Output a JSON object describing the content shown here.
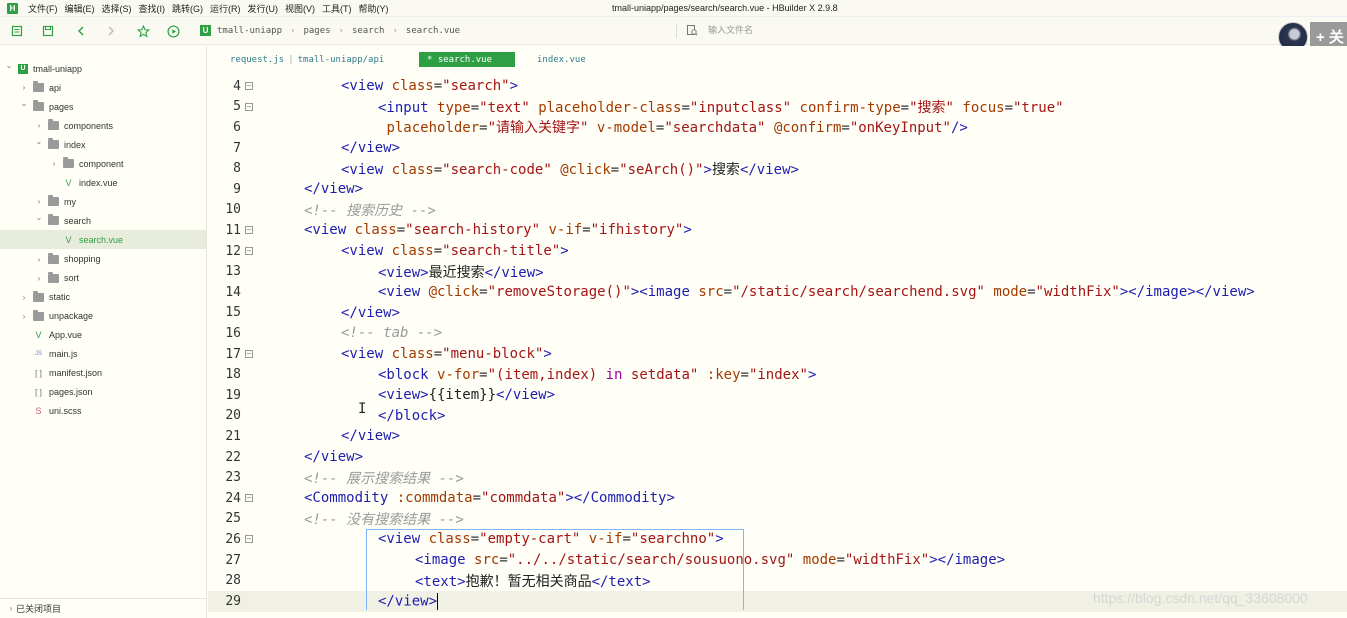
{
  "menubar": {
    "logo": "H",
    "items": [
      "文件(F)",
      "编辑(E)",
      "选择(S)",
      "查找(I)",
      "跳转(G)",
      "运行(R)",
      "发行(U)",
      "视图(V)",
      "工具(T)",
      "帮助(Y)"
    ],
    "window_title": "tmall-uniapp/pages/search/search.vue - HBuilder X 2.9.8"
  },
  "toolbar": {
    "breadcrumb_logo": "U",
    "breadcrumb": [
      "tmall-uniapp",
      "pages",
      "search",
      "search.vue"
    ],
    "file_search_placeholder": "输入文件名",
    "plus_label": "+ 关"
  },
  "sidebar": {
    "tree": [
      {
        "label": "tmall-uniapp",
        "kind": "project",
        "expanded": true,
        "depth": 0
      },
      {
        "label": "api",
        "kind": "folder",
        "expanded": false,
        "depth": 1
      },
      {
        "label": "pages",
        "kind": "folder",
        "expanded": true,
        "depth": 1
      },
      {
        "label": "components",
        "kind": "folder",
        "expanded": false,
        "depth": 2
      },
      {
        "label": "index",
        "kind": "folder",
        "expanded": true,
        "depth": 2
      },
      {
        "label": "component",
        "kind": "folder",
        "expanded": false,
        "depth": 3
      },
      {
        "label": "index.vue",
        "kind": "vue",
        "depth": 3
      },
      {
        "label": "my",
        "kind": "folder",
        "expanded": false,
        "depth": 2
      },
      {
        "label": "search",
        "kind": "folder",
        "expanded": true,
        "depth": 2
      },
      {
        "label": "search.vue",
        "kind": "vue",
        "depth": 3,
        "selected": true
      },
      {
        "label": "shopping",
        "kind": "folder",
        "expanded": false,
        "depth": 2
      },
      {
        "label": "sort",
        "kind": "folder",
        "expanded": false,
        "depth": 2
      },
      {
        "label": "static",
        "kind": "folder",
        "expanded": false,
        "depth": 1
      },
      {
        "label": "unpackage",
        "kind": "folder",
        "expanded": false,
        "depth": 1
      },
      {
        "label": "App.vue",
        "kind": "vue",
        "depth": 1
      },
      {
        "label": "main.js",
        "kind": "js",
        "depth": 1
      },
      {
        "label": "manifest.json",
        "kind": "json",
        "depth": 1
      },
      {
        "label": "pages.json",
        "kind": "json",
        "depth": 1
      },
      {
        "label": "uni.scss",
        "kind": "scss",
        "depth": 1
      }
    ],
    "closed_items_label": "已关闭项目"
  },
  "tabs": [
    {
      "label": "request.js",
      "sub": "tmall-uniapp/api",
      "active": false
    },
    {
      "label": "* search.vue",
      "active": true
    },
    {
      "label": "index.vue",
      "active": false
    }
  ],
  "editor": {
    "lines": [
      {
        "n": "4",
        "fold": true,
        "indent": 2,
        "tokens": [
          [
            "t",
            "<view "
          ],
          [
            "a",
            "class"
          ],
          [
            "s",
            "="
          ],
          [
            "sv",
            "\"search\""
          ],
          [
            "t",
            ">"
          ]
        ]
      },
      {
        "n": "5",
        "fold": true,
        "indent": 3,
        "tokens": [
          [
            "t",
            "<input "
          ],
          [
            "a",
            "type"
          ],
          [
            "s",
            "="
          ],
          [
            "sv",
            "\"text\""
          ],
          [
            "s",
            " "
          ],
          [
            "a",
            "placeholder-class"
          ],
          [
            "s",
            "="
          ],
          [
            "sv",
            "\"inputclass\""
          ],
          [
            "s",
            " "
          ],
          [
            "a",
            "confirm-type"
          ],
          [
            "s",
            "="
          ],
          [
            "sv",
            "\"搜索\""
          ],
          [
            "s",
            " "
          ],
          [
            "a",
            "focus"
          ],
          [
            "s",
            "="
          ],
          [
            "sv",
            "\"true\""
          ]
        ]
      },
      {
        "n": "6",
        "fold": false,
        "indent": 3,
        "tokens": [
          [
            "s",
            " "
          ],
          [
            "a",
            "placeholder"
          ],
          [
            "s",
            "="
          ],
          [
            "sv",
            "\"请输入关键字\""
          ],
          [
            "s",
            " "
          ],
          [
            "a",
            "v-model"
          ],
          [
            "s",
            "="
          ],
          [
            "sv",
            "\"searchdata\""
          ],
          [
            "s",
            " "
          ],
          [
            "a",
            "@confirm"
          ],
          [
            "s",
            "="
          ],
          [
            "sv",
            "\"onKeyInput\""
          ],
          [
            "t",
            "/>"
          ]
        ]
      },
      {
        "n": "7",
        "fold": false,
        "indent": 2,
        "tokens": [
          [
            "t",
            "</view>"
          ]
        ]
      },
      {
        "n": "8",
        "fold": false,
        "indent": 2,
        "tokens": [
          [
            "t",
            "<view "
          ],
          [
            "a",
            "class"
          ],
          [
            "s",
            "="
          ],
          [
            "sv",
            "\"search-code\""
          ],
          [
            "s",
            " "
          ],
          [
            "a",
            "@click"
          ],
          [
            "s",
            "="
          ],
          [
            "sv",
            "\"seArch()\""
          ],
          [
            "t",
            ">"
          ],
          [
            "tx",
            "搜索"
          ],
          [
            "t",
            "</view>"
          ]
        ]
      },
      {
        "n": "9",
        "fold": false,
        "indent": 1,
        "tokens": [
          [
            "t",
            "</view>"
          ]
        ]
      },
      {
        "n": "10",
        "fold": false,
        "indent": 1,
        "tokens": [
          [
            "c",
            "<!-- 搜索历史 -->"
          ]
        ]
      },
      {
        "n": "11",
        "fold": true,
        "indent": 1,
        "tokens": [
          [
            "t",
            "<view "
          ],
          [
            "a",
            "class"
          ],
          [
            "s",
            "="
          ],
          [
            "sv",
            "\"search-history\""
          ],
          [
            "s",
            " "
          ],
          [
            "a",
            "v-if"
          ],
          [
            "s",
            "="
          ],
          [
            "sv",
            "\"ifhistory\""
          ],
          [
            "t",
            ">"
          ]
        ]
      },
      {
        "n": "12",
        "fold": true,
        "indent": 2,
        "tokens": [
          [
            "t",
            "<view "
          ],
          [
            "a",
            "class"
          ],
          [
            "s",
            "="
          ],
          [
            "sv",
            "\"search-title\""
          ],
          [
            "t",
            ">"
          ]
        ]
      },
      {
        "n": "13",
        "fold": false,
        "indent": 3,
        "tokens": [
          [
            "t",
            "<view>"
          ],
          [
            "tx",
            "最近搜索"
          ],
          [
            "t",
            "</view>"
          ]
        ]
      },
      {
        "n": "14",
        "fold": false,
        "indent": 3,
        "tokens": [
          [
            "t",
            "<view "
          ],
          [
            "a",
            "@click"
          ],
          [
            "s",
            "="
          ],
          [
            "sv",
            "\"removeStorage()\""
          ],
          [
            "t",
            ">"
          ],
          [
            "t",
            "<image "
          ],
          [
            "a",
            "src"
          ],
          [
            "s",
            "="
          ],
          [
            "sv",
            "\"/static/search/searchend.svg\""
          ],
          [
            "s",
            " "
          ],
          [
            "a",
            "mode"
          ],
          [
            "s",
            "="
          ],
          [
            "sv",
            "\"widthFix\""
          ],
          [
            "t",
            "></image></view>"
          ]
        ]
      },
      {
        "n": "15",
        "fold": false,
        "indent": 2,
        "tokens": [
          [
            "t",
            "</view>"
          ]
        ]
      },
      {
        "n": "16",
        "fold": false,
        "indent": 2,
        "tokens": [
          [
            "c",
            "<!-- tab -->"
          ]
        ]
      },
      {
        "n": "17",
        "fold": true,
        "indent": 2,
        "tokens": [
          [
            "t",
            "<view "
          ],
          [
            "a",
            "class"
          ],
          [
            "s",
            "="
          ],
          [
            "sv",
            "\"menu-block\""
          ],
          [
            "t",
            ">"
          ]
        ]
      },
      {
        "n": "18",
        "fold": false,
        "indent": 3,
        "tokens": [
          [
            "t",
            "<block "
          ],
          [
            "a",
            "v-for"
          ],
          [
            "s",
            "="
          ],
          [
            "sv",
            "\"(item,index) "
          ],
          [
            "kw",
            "in"
          ],
          [
            "sv",
            " setdata\""
          ],
          [
            "s",
            " "
          ],
          [
            "a",
            ":key"
          ],
          [
            "s",
            "="
          ],
          [
            "sv",
            "\"index\""
          ],
          [
            "t",
            ">"
          ]
        ]
      },
      {
        "n": "19",
        "fold": false,
        "indent": 3,
        "tokens": [
          [
            "t",
            "<view>"
          ],
          [
            "tx",
            "{{item}}"
          ],
          [
            "t",
            "</view>"
          ]
        ]
      },
      {
        "n": "20",
        "fold": false,
        "indent": 3,
        "tokens": [
          [
            "t",
            "</block>"
          ]
        ]
      },
      {
        "n": "21",
        "fold": false,
        "indent": 2,
        "tokens": [
          [
            "t",
            "</view>"
          ]
        ]
      },
      {
        "n": "22",
        "fold": false,
        "indent": 1,
        "tokens": [
          [
            "t",
            "</view>"
          ]
        ]
      },
      {
        "n": "23",
        "fold": false,
        "indent": 1,
        "tokens": [
          [
            "c",
            "<!-- 展示搜索结果 -->"
          ]
        ]
      },
      {
        "n": "24",
        "fold": true,
        "indent": 1,
        "tokens": [
          [
            "t",
            "<Commodity "
          ],
          [
            "a",
            ":commdata"
          ],
          [
            "s",
            "="
          ],
          [
            "sv",
            "\"commdata\""
          ],
          [
            "t",
            "></Commodity>"
          ]
        ]
      },
      {
        "n": "25",
        "fold": false,
        "indent": 1,
        "tokens": [
          [
            "c",
            "<!-- 没有搜索结果 -->"
          ]
        ]
      },
      {
        "n": "26",
        "fold": true,
        "indent": 3,
        "tokens": [
          [
            "t",
            "<view "
          ],
          [
            "a",
            "class"
          ],
          [
            "s",
            "="
          ],
          [
            "sv",
            "\"empty-cart\""
          ],
          [
            "s",
            " "
          ],
          [
            "a",
            "v-if"
          ],
          [
            "s",
            "="
          ],
          [
            "sv",
            "\"searchno\""
          ],
          [
            "t",
            ">"
          ]
        ]
      },
      {
        "n": "27",
        "fold": false,
        "indent": 4,
        "tokens": [
          [
            "t",
            "<image "
          ],
          [
            "a",
            "src"
          ],
          [
            "s",
            "="
          ],
          [
            "sv",
            "\"../../static/search/sousuono.svg\""
          ],
          [
            "s",
            " "
          ],
          [
            "a",
            "mode"
          ],
          [
            "s",
            "="
          ],
          [
            "sv",
            "\"widthFix\""
          ],
          [
            "t",
            "></image>"
          ]
        ]
      },
      {
        "n": "28",
        "fold": false,
        "indent": 4,
        "tokens": [
          [
            "t",
            "<text>"
          ],
          [
            "tx",
            "抱歉！暂无相关商品"
          ],
          [
            "t",
            "</text>"
          ]
        ]
      },
      {
        "n": "29",
        "fold": false,
        "indent": 3,
        "current": true,
        "tokens": [
          [
            "t",
            "</view>"
          ]
        ]
      }
    ]
  },
  "watermark": "https://blog.csdn.net/qq_33608000"
}
